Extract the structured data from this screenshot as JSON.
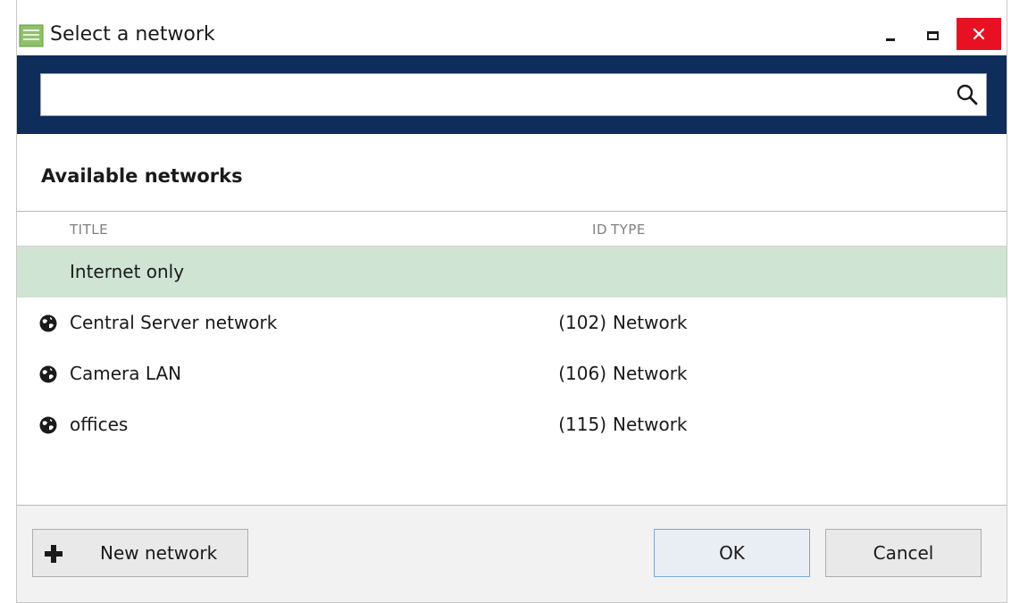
{
  "window": {
    "title": "Select a network",
    "controls": {
      "minimize_icon": "minimize-icon",
      "maximize_icon": "maximize-icon",
      "close_icon": "close-icon"
    }
  },
  "search": {
    "value": "",
    "placeholder": "",
    "icon": "search-icon"
  },
  "section": {
    "title": "Available networks"
  },
  "table": {
    "columns": {
      "title": "TITLE",
      "id": "ID",
      "type": "TYPE"
    },
    "rows": [
      {
        "icon": "",
        "title": "Internet only",
        "id": "",
        "type": "",
        "selected": true
      },
      {
        "icon": "globe-icon",
        "title": "Central Server network",
        "id": "(102)",
        "type": "Network",
        "selected": false
      },
      {
        "icon": "globe-icon",
        "title": "Camera LAN",
        "id": "(106)",
        "type": "Network",
        "selected": false
      },
      {
        "icon": "globe-icon",
        "title": "offices",
        "id": "(115)",
        "type": "Network",
        "selected": false
      }
    ]
  },
  "footer": {
    "new_network_label": "New network",
    "ok_label": "OK",
    "cancel_label": "Cancel"
  },
  "colors": {
    "accent_band": "#0e2d5a",
    "selected_row": "#cfe4d3",
    "close_button": "#e81123"
  }
}
